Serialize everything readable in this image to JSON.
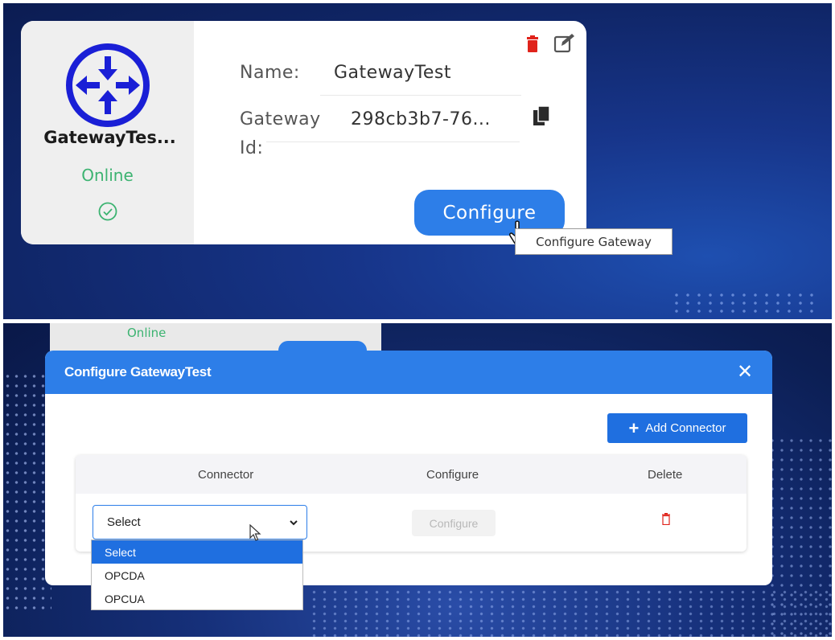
{
  "gateway_card": {
    "display_name": "GatewayTes...",
    "status": "Online",
    "name_label": "Name:",
    "name_value": "GatewayTest",
    "gateway_label_line1": "Gateway",
    "gateway_label_line2": "Id:",
    "gateway_id_value": "298cb3b7-76...",
    "configure_label": "Configure",
    "tooltip": "Configure Gateway",
    "icon": "gateway-router-icon",
    "status_color": "#3cb371",
    "accent": "#2d7ee8"
  },
  "background_card": {
    "status": "Online"
  },
  "modal": {
    "title": "Configure GatewayTest",
    "close_icon": "close-icon",
    "add_connector_label": "Add Connector",
    "table": {
      "columns": [
        "Connector",
        "Configure",
        "Delete"
      ],
      "row": {
        "select_value": "Select",
        "configure_label": "Configure",
        "delete_icon": "trash-icon"
      }
    },
    "dropdown_options": [
      "Select",
      "OPCDA",
      "OPCUA"
    ]
  }
}
